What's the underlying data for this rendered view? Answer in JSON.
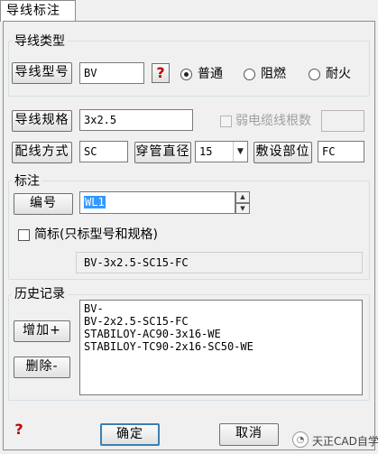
{
  "window": {
    "title": "导线标注"
  },
  "wire_type_group": {
    "label": "导线类型",
    "model_button": "导线型号",
    "model_value": "BV",
    "help_icon": "question-icon",
    "radios": [
      {
        "label": "普通",
        "checked": true
      },
      {
        "label": "阻燃",
        "checked": false
      },
      {
        "label": "耐火",
        "checked": false
      }
    ]
  },
  "spec": {
    "spec_button": "导线规格",
    "spec_value": "3x2.5",
    "weak_cable_label": "弱电缆线根数",
    "weak_cable_value": "",
    "method_button": "配线方式",
    "method_value": "SC",
    "pipe_button": "穿管直径",
    "pipe_value": "15",
    "location_button": "敷设部位",
    "location_value": "FC"
  },
  "annotation_group": {
    "label": "标注",
    "number_button": "编号",
    "number_value": "WL1",
    "simple_label": "简标(只标型号和规格)",
    "simple_checked": false,
    "preview": "BV-3x2.5-SC15-FC"
  },
  "history_group": {
    "label": "历史记录",
    "add_button": "增加+",
    "delete_button": "删除-",
    "items": [
      "BV-",
      "BV-2x2.5-SC15-FC",
      "STABILOY-AC90-3x16-WE",
      "STABILOY-TC90-2x16-SC50-WE"
    ]
  },
  "footer": {
    "help_icon": "question-icon",
    "ok_button": "确定",
    "cancel_button": "取消",
    "watermark": "天正CAD自学"
  }
}
